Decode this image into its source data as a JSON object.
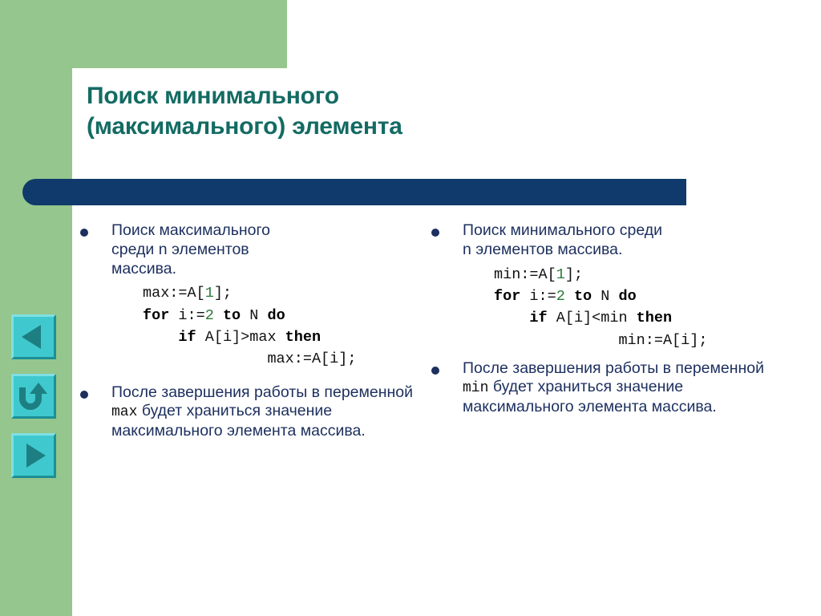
{
  "slide": {
    "title_lines": [
      "Поиск минимального",
      "(максимального) элемента"
    ],
    "colors": {
      "green": "#95c68d",
      "title_teal": "#136b63",
      "navy_bar": "#103a6b",
      "body_navy": "#1c2f5e",
      "code_black": "#111111",
      "code_number_green": "#2a7a35",
      "button_face_cyan": "#3fc9ce",
      "button_glyph_teal": "#1d7f82"
    }
  },
  "nav_buttons": [
    {
      "name": "previous-slide-button",
      "icon": "triangle-left-icon",
      "label": "Назад"
    },
    {
      "name": "return-button",
      "icon": "u-turn-arrow-icon",
      "label": "Возврат"
    },
    {
      "name": "next-slide-button",
      "icon": "triangle-right-icon",
      "label": "Вперёд"
    }
  ],
  "left_column": {
    "bullet1": {
      "text_lines": [
        "Поиск максимального",
        "среди n элементов",
        "массива."
      ],
      "code": [
        {
          "indent": 0,
          "tokens": [
            {
              "t": "max:=A[",
              "k": "plain"
            },
            {
              "t": "1",
              "k": "num"
            },
            {
              "t": "];",
              "k": "plain"
            }
          ]
        },
        {
          "indent": 0,
          "tokens": [
            {
              "t": "for",
              "k": "kw"
            },
            {
              "t": " i:=",
              "k": "plain"
            },
            {
              "t": "2",
              "k": "num"
            },
            {
              "t": " ",
              "k": "plain"
            },
            {
              "t": "to",
              "k": "kw"
            },
            {
              "t": " N ",
              "k": "plain"
            },
            {
              "t": "do",
              "k": "kw"
            }
          ]
        },
        {
          "indent": 2,
          "tokens": [
            {
              "t": "if",
              "k": "kw"
            },
            {
              "t": " A[i]>max ",
              "k": "plain"
            },
            {
              "t": "then",
              "k": "kw"
            }
          ]
        },
        {
          "indent": 7,
          "tokens": [
            {
              "t": "max:=A[i];",
              "k": "plain"
            }
          ]
        }
      ]
    },
    "bullet2": {
      "segments": [
        {
          "t": "После завершения работы в переменной ",
          "k": "prose"
        },
        {
          "t": "max",
          "k": "mono"
        },
        {
          "t": " будет храниться значение максимального элемента массива.",
          "k": "prose"
        }
      ]
    }
  },
  "right_column": {
    "bullet1": {
      "text_lines": [
        "Поиск минимального среди",
        "n элементов массива."
      ],
      "code": [
        {
          "indent": 0,
          "tokens": [
            {
              "t": "min:=A[",
              "k": "plain"
            },
            {
              "t": "1",
              "k": "num"
            },
            {
              "t": "];",
              "k": "plain"
            }
          ]
        },
        {
          "indent": 0,
          "tokens": [
            {
              "t": "for",
              "k": "kw"
            },
            {
              "t": " i:=",
              "k": "plain"
            },
            {
              "t": "2",
              "k": "num"
            },
            {
              "t": " ",
              "k": "plain"
            },
            {
              "t": "to",
              "k": "kw"
            },
            {
              "t": " N ",
              "k": "plain"
            },
            {
              "t": "do",
              "k": "kw"
            }
          ]
        },
        {
          "indent": 2,
          "tokens": [
            {
              "t": "if",
              "k": "kw"
            },
            {
              "t": " A[i]<min ",
              "k": "plain"
            },
            {
              "t": "then",
              "k": "kw"
            }
          ]
        },
        {
          "indent": 7,
          "tokens": [
            {
              "t": "min:=A[i];",
              "k": "plain"
            }
          ]
        }
      ]
    },
    "bullet2": {
      "segments": [
        {
          "t": "После завершения работы в переменной ",
          "k": "prose"
        },
        {
          "t": "min",
          "k": "mono"
        },
        {
          "t": " будет храниться значение максимального элемента массива.",
          "k": "prose"
        }
      ]
    }
  }
}
